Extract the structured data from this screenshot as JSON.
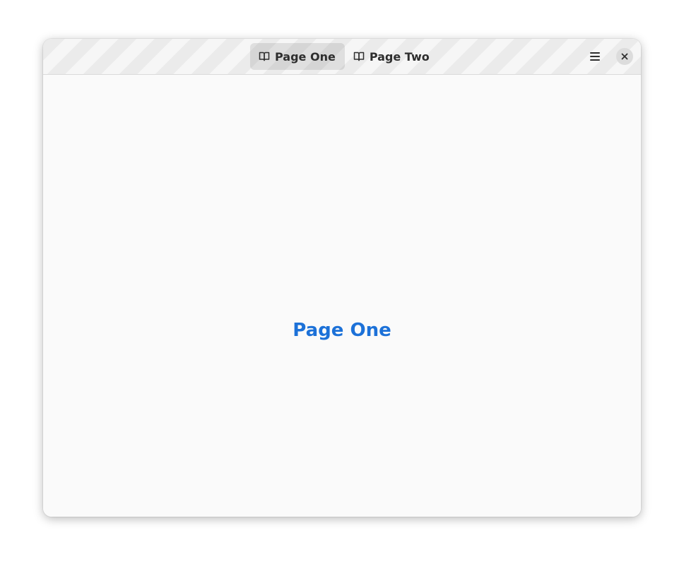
{
  "window": {
    "tabs": [
      {
        "label": "Page One",
        "icon": "book-icon",
        "active": true
      },
      {
        "label": "Page Two",
        "icon": "book-icon",
        "active": false
      }
    ],
    "menu_icon": "hamburger-menu-icon",
    "close_icon": "close-icon"
  },
  "content": {
    "title": "Page One"
  },
  "colors": {
    "accent": "#1c71d8",
    "headerbar": "#ebebeb",
    "content_bg": "#fafafa"
  }
}
